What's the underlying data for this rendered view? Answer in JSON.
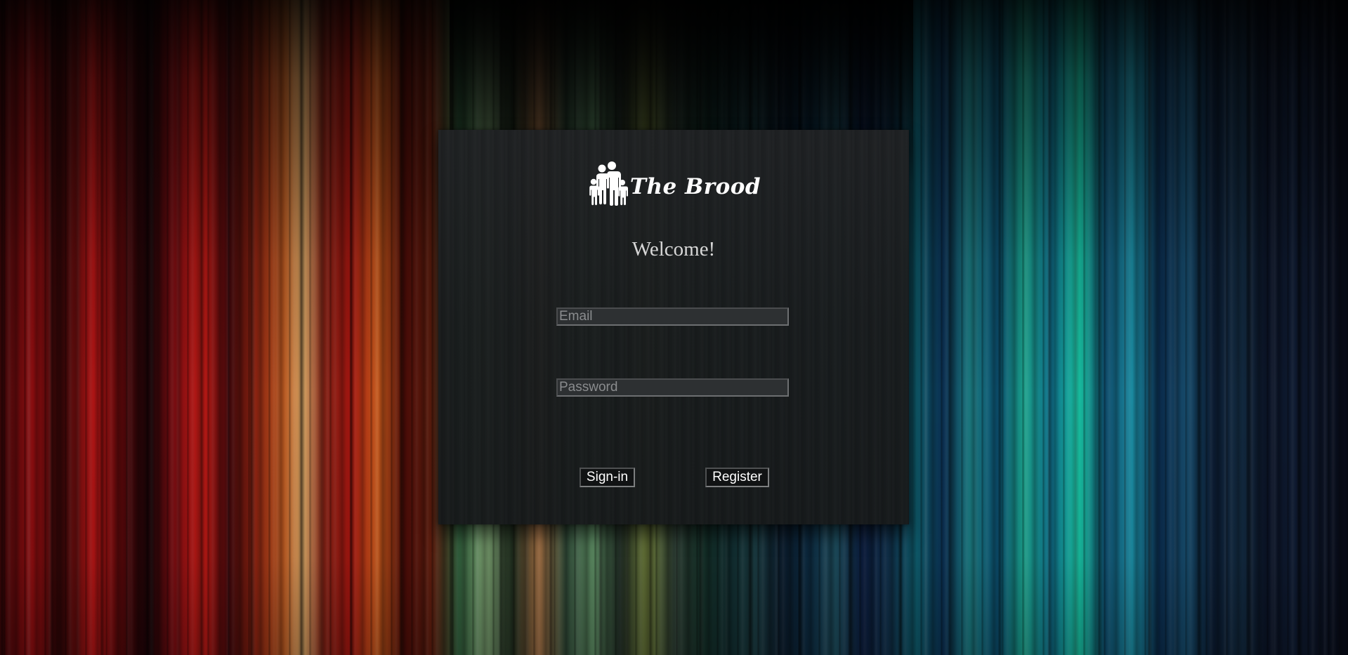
{
  "brand": {
    "name": "The Brood",
    "logo_icon": "family-icon",
    "logo_color": "#ffffff"
  },
  "welcome": {
    "heading": "Welcome!"
  },
  "form": {
    "email": {
      "value": "",
      "placeholder": "Email"
    },
    "password": {
      "value": "",
      "placeholder": "Password"
    },
    "signin_label": "Sign-in",
    "register_label": "Register"
  },
  "theme": {
    "card_background": "#1c1f20",
    "input_background": "#2d3032",
    "button_background": "#111314",
    "text_color": "#ffffff"
  }
}
